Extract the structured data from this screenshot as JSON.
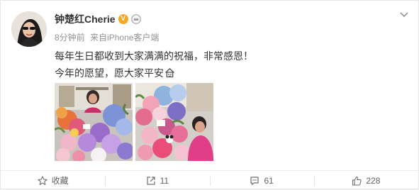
{
  "post": {
    "author": {
      "name": "钟楚红Cherie",
      "verified_badge": "V"
    },
    "meta": {
      "time": "8分钟前",
      "source_prefix": "来自",
      "source": "iPhone客户端"
    },
    "text_lines": [
      "每年生日都收到大家满满的祝福，非常感恩！",
      "今年的愿望，愿大家平安"
    ],
    "emoji_icon": "home-emoji-icon",
    "photos": [
      {
        "alt_icon": "photo-flowers-woman-left"
      },
      {
        "alt_icon": "photo-flowers-woman-right"
      }
    ]
  },
  "actions": {
    "favorite": {
      "label": "收藏",
      "icon": "star-icon"
    },
    "repost": {
      "count": "11",
      "icon": "repost-icon"
    },
    "comment": {
      "count": "61",
      "icon": "comment-icon"
    },
    "like": {
      "count": "228",
      "icon": "thumbs-up-icon"
    }
  },
  "colors": {
    "verified": "#f5a623",
    "meta_text": "#939393",
    "action_text": "#636363"
  }
}
